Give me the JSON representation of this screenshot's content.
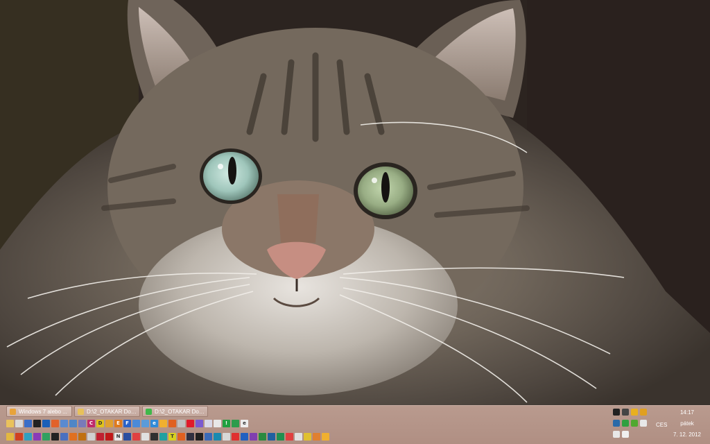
{
  "taskbar": {
    "tasks": [
      {
        "label": "Windows 7 alebo ...",
        "icon": "chrome-icon",
        "color": "#e8a33a"
      },
      {
        "label": "D:\\2_OTAKAR Dok...",
        "icon": "folder-icon",
        "color": "#e7c15a"
      },
      {
        "label": "D:\\2_OTAKAR Dok...",
        "icon": "chat-icon",
        "color": "#3fb84a"
      }
    ]
  },
  "quick_launch_row1": [
    {
      "icon": "folder-icon",
      "color": "#e9c25c",
      "glyph": ""
    },
    {
      "icon": "document-icon",
      "color": "#d9d9d9",
      "glyph": ""
    },
    {
      "icon": "window-icon",
      "color": "#3a6ec8",
      "glyph": ""
    },
    {
      "icon": "monitor-icon",
      "color": "#222222",
      "glyph": ""
    },
    {
      "icon": "globe-icon",
      "color": "#1b5fb8",
      "glyph": ""
    },
    {
      "icon": "firefox-icon",
      "color": "#e2622a",
      "glyph": ""
    },
    {
      "icon": "network-icon",
      "color": "#5a8ad0",
      "glyph": ""
    },
    {
      "icon": "computer-icon",
      "color": "#4f86c6",
      "glyph": ""
    },
    {
      "icon": "users-icon",
      "color": "#7a7ab8",
      "glyph": ""
    },
    {
      "icon": "drive-c-icon",
      "color": "#c02a6a",
      "glyph": "C"
    },
    {
      "icon": "drive-d-icon",
      "color": "#e0c21c",
      "glyph": "D"
    },
    {
      "icon": "gear-icon",
      "color": "#e0a030",
      "glyph": ""
    },
    {
      "icon": "drive-e-icon",
      "color": "#e07a1c",
      "glyph": "E"
    },
    {
      "icon": "drive-f-icon",
      "color": "#2a62c8",
      "glyph": "F"
    },
    {
      "icon": "printer-icon",
      "color": "#4a8ad8",
      "glyph": ""
    },
    {
      "icon": "scanner-icon",
      "color": "#5b9bd8",
      "glyph": ""
    },
    {
      "icon": "ie-icon",
      "color": "#2f8ad8",
      "glyph": "e"
    },
    {
      "icon": "chrome-icon",
      "color": "#f0b030",
      "glyph": ""
    },
    {
      "icon": "firefox-icon",
      "color": "#e06020",
      "glyph": ""
    },
    {
      "icon": "mail-icon",
      "color": "#c0c0c0",
      "glyph": ""
    },
    {
      "icon": "skype-icon",
      "color": "#e01a2a",
      "glyph": ""
    },
    {
      "icon": "messenger-icon",
      "color": "#7a5ad0",
      "glyph": ""
    },
    {
      "icon": "notepad-icon",
      "color": "#d8d8e8",
      "glyph": ""
    },
    {
      "icon": "calculator-icon",
      "color": "#e8e8e8",
      "glyph": ""
    },
    {
      "icon": "warning-icon",
      "color": "#20a040",
      "glyph": "!"
    },
    {
      "icon": "download-icon",
      "color": "#2c9c4c",
      "glyph": ""
    },
    {
      "icon": "text-icon",
      "color": "#eeeeee",
      "glyph": "e"
    }
  ],
  "quick_launch_row2": [
    {
      "icon": "folder-icon",
      "color": "#e3b840",
      "glyph": ""
    },
    {
      "icon": "office-icon",
      "color": "#d04020",
      "glyph": ""
    },
    {
      "icon": "user-icon",
      "color": "#30a0c0",
      "glyph": ""
    },
    {
      "icon": "chat-icon",
      "color": "#8a3ab8",
      "glyph": ""
    },
    {
      "icon": "camera-icon",
      "color": "#30a060",
      "glyph": ""
    },
    {
      "icon": "film-icon",
      "color": "#222222",
      "glyph": ""
    },
    {
      "icon": "box-icon",
      "color": "#4a70c0",
      "glyph": ""
    },
    {
      "icon": "music-icon",
      "color": "#e07020",
      "glyph": ""
    },
    {
      "icon": "archive-icon",
      "color": "#c07010",
      "glyph": ""
    },
    {
      "icon": "media-icon",
      "color": "#d0d0d0",
      "glyph": ""
    },
    {
      "icon": "cross-icon",
      "color": "#c02030",
      "glyph": ""
    },
    {
      "icon": "pdf-icon",
      "color": "#c01818",
      "glyph": ""
    },
    {
      "icon": "n-icon",
      "color": "#e8e8e8",
      "glyph": "N"
    },
    {
      "icon": "image-icon",
      "color": "#2a4ea0",
      "glyph": ""
    },
    {
      "icon": "toolbar-icon",
      "color": "#e04040",
      "glyph": ""
    },
    {
      "icon": "calendar-icon",
      "color": "#e0e0e0",
      "glyph": ""
    },
    {
      "icon": "settings-icon",
      "color": "#303030",
      "glyph": ""
    },
    {
      "icon": "terminal-icon",
      "color": "#20a0a0",
      "glyph": ""
    },
    {
      "icon": "t-icon",
      "color": "#d8d020",
      "glyph": "T"
    },
    {
      "icon": "presentation-icon",
      "color": "#e06020",
      "glyph": ""
    },
    {
      "icon": "video-icon",
      "color": "#303040",
      "glyph": ""
    },
    {
      "icon": "brush-icon",
      "color": "#202020",
      "glyph": ""
    },
    {
      "icon": "wave-icon",
      "color": "#3a6ab8",
      "glyph": ""
    },
    {
      "icon": "grid-icon",
      "color": "#1a8ab0",
      "glyph": ""
    },
    {
      "icon": "shield-icon",
      "color": "#d8d8d8",
      "glyph": ""
    },
    {
      "icon": "plus-icon",
      "color": "#e03030",
      "glyph": ""
    },
    {
      "icon": "list-icon",
      "color": "#2060c0",
      "glyph": ""
    },
    {
      "icon": "bars-icon",
      "color": "#8040b0",
      "glyph": ""
    },
    {
      "icon": "stack-icon",
      "color": "#2a8a40",
      "glyph": ""
    },
    {
      "icon": "book-icon",
      "color": "#2060a0",
      "glyph": ""
    },
    {
      "icon": "sheet-icon",
      "color": "#209050",
      "glyph": ""
    },
    {
      "icon": "sync-icon",
      "color": "#e04040",
      "glyph": ""
    },
    {
      "icon": "paper-icon",
      "color": "#e0e0e0",
      "glyph": ""
    },
    {
      "icon": "lock-icon",
      "color": "#e0c030",
      "glyph": ""
    },
    {
      "icon": "badge-icon",
      "color": "#e08030",
      "glyph": ""
    },
    {
      "icon": "chrome-icon",
      "color": "#f0b030",
      "glyph": ""
    }
  ],
  "tray": {
    "row1": [
      {
        "icon": "monitor-tray-icon",
        "color": "#222222"
      },
      {
        "icon": "sync-tray-icon",
        "color": "#444444"
      },
      {
        "icon": "smiley-icon",
        "color": "#e8b020"
      },
      {
        "icon": "emoticon-icon",
        "color": "#e0a020"
      }
    ],
    "row2": [
      {
        "icon": "network-tray-icon",
        "color": "#2a6aa8"
      },
      {
        "icon": "shield-tray-icon",
        "color": "#30a040"
      },
      {
        "icon": "update-icon",
        "color": "#50a830"
      },
      {
        "icon": "flag-icon",
        "color": "#e8e8e8"
      }
    ],
    "row3": [
      {
        "icon": "chat-tray-icon",
        "color": "#e8e8e8"
      },
      {
        "icon": "speaker-icon",
        "color": "#f0f0f0"
      }
    ],
    "language": "CES"
  },
  "clock": {
    "time": "14:17",
    "day": "pátek",
    "date": "7. 12. 2012"
  }
}
